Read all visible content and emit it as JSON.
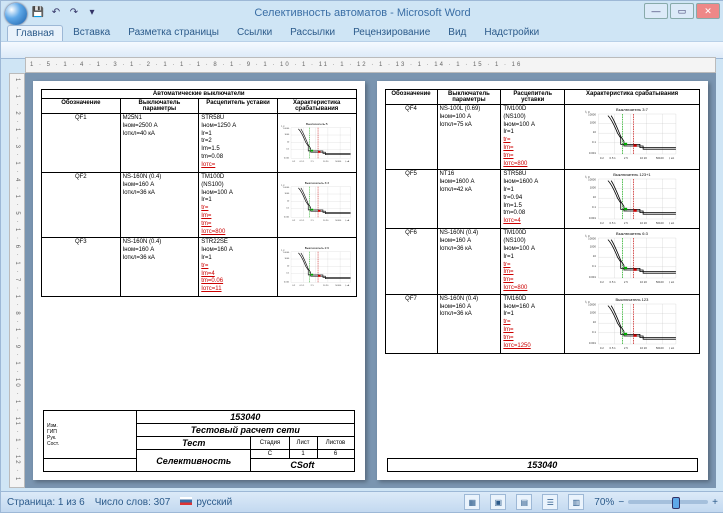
{
  "app": {
    "title": "Селективность автоматов - Microsoft Word"
  },
  "qat": [
    "💾",
    "↶",
    "↷",
    "▾"
  ],
  "tabs": [
    "Главная",
    "Вставка",
    "Разметка страницы",
    "Ссылки",
    "Рассылки",
    "Рецензирование",
    "Вид",
    "Надстройки"
  ],
  "active_tab": 0,
  "ruler_text": "1 · 5 · 1 · 4 · 1 · 3 · 1 · 2 · 1 · 1 · 1 · 8 · 1 · 9 · 1 · 10 · 1 · 11 · 1 · 12 · 1 · 13 · 1 · 14 · 1 · 15 · 1 · 16",
  "vruler_text": "1 · 1 · 2 · 1 · 3 · 1 · 4 · 1 · 5 · 1 · 6 · 1 · 7 · 1 · 8 · 1 · 9 · 1 · 10 · 1 · 11 · 1 · 12 · 1 · 13",
  "page_left": {
    "caption": "Автоматические выключатели",
    "headers": [
      "Обозначение",
      "Выключатель параметры",
      "Расцепитель уставки",
      "Характеристика срабатывания"
    ],
    "rows": [
      {
        "id": "QF1",
        "sw": [
          "M25N1",
          "Iном=2500 А",
          "Iоткл=40 кА"
        ],
        "trip": [
          "STR58U",
          "Iном=1250 А",
          "Ir=1",
          "tr=2",
          "Im=1.5",
          "tm=0.08"
        ],
        "trip_red": [
          "Iотс="
        ],
        "chart_title": "Выключатель:5"
      },
      {
        "id": "QF2",
        "sw": [
          "NS-160N (0.4)",
          "Iном=160 А",
          "Iоткл=36 кА"
        ],
        "trip": [
          "TM100D",
          "(NS100)",
          "Iном=100 А",
          "Ir=1"
        ],
        "trip_red": [
          "tr=",
          "Im=",
          "tm=",
          "Iотс=800"
        ],
        "chart_title": "Выключатель 3:3"
      },
      {
        "id": "QF3",
        "sw": [
          "NS-160N (0.4)",
          "Iном=160 А",
          "Iоткл=36 кА"
        ],
        "trip": [
          "STR22SE",
          "Iном=160 А",
          "Ir=1"
        ],
        "trip_red": [
          "tr=",
          "Im=4",
          "tm=0.06",
          "Iотс=11"
        ],
        "chart_title": "Выключатель 2:6"
      }
    ]
  },
  "page_right": {
    "headers": [
      "Обозначение",
      "Выключатель параметры",
      "Расцепитель уставки",
      "Характеристика срабатывания"
    ],
    "rows": [
      {
        "id": "QF4",
        "sw": [
          "NS-100L (0.69)",
          "Iном=100 А",
          "Iоткл=75 кА"
        ],
        "trip": [
          "TM100D",
          "(NS100)",
          "Iном=100 А",
          "Ir=1"
        ],
        "trip_red": [
          "tr=",
          "Im=",
          "tm=",
          "Iотс=800"
        ],
        "chart_title": "Выключатель 3:7"
      },
      {
        "id": "QF5",
        "sw": [
          "NT16",
          "Iном=1600 А",
          "Iоткл=42 кА"
        ],
        "trip": [
          "STR58U",
          "Iном=1600 А",
          "Ir=1",
          "tr=0.94",
          "Im=1.5",
          "tm=0.08"
        ],
        "trip_red": [
          "Iотс=4"
        ],
        "chart_title": "Выключатель 123+1"
      },
      {
        "id": "QF6",
        "sw": [
          "NS-160N (0.4)",
          "Iном=160 А",
          "Iоткл=36 кА"
        ],
        "trip": [
          "TM100D",
          "(NS100)",
          "Iном=100 А",
          "Ir=1"
        ],
        "trip_red": [
          "tr=",
          "Im=",
          "tm=",
          "Iотс=800"
        ],
        "chart_title": "Выключатель 6:3"
      },
      {
        "id": "QF7",
        "sw": [
          "NS-160N (0.4)",
          "Iном=160 А",
          "Iоткл=36 кА"
        ],
        "trip": [
          "TM160D",
          "Iном=160 А",
          "Ir=1"
        ],
        "trip_red": [
          "tr=",
          "Im=",
          "tm=",
          "Iотс=1250"
        ],
        "chart_title": "Выключатель 123"
      }
    ]
  },
  "titleblock": {
    "code": "153040",
    "line2": "Тестовый расчет сети",
    "line3": "Тест",
    "line4": "Селективность",
    "company": "CSoft",
    "cols": [
      "Стадия",
      "Лист",
      "Листов"
    ],
    "vals": [
      "С",
      "1",
      "6"
    ],
    "small_rows": [
      "Изм.",
      "ГИП",
      "Рук.",
      "Сост."
    ],
    "code_right": "153040"
  },
  "status": {
    "page": "Страница: 1 из 6",
    "words": "Число слов: 307",
    "lang": "русский",
    "zoom": "70%"
  },
  "chart_data": [
    {
      "type": "line",
      "title": "Выключатель:5",
      "xlabel": "I, кА",
      "ylabel": "t, c",
      "x_ticks": [
        "0.2",
        "0.5",
        "1",
        "2",
        "5",
        "10",
        "20",
        "50",
        "100"
      ],
      "y_ticks": [
        "0.001",
        "0.01",
        "0.1",
        "1",
        "10",
        "100",
        "1000",
        "10000"
      ],
      "series": [
        {
          "name": "curve",
          "approx": true,
          "shape": "inverse-time trip curve descending then flat"
        }
      ]
    }
  ]
}
